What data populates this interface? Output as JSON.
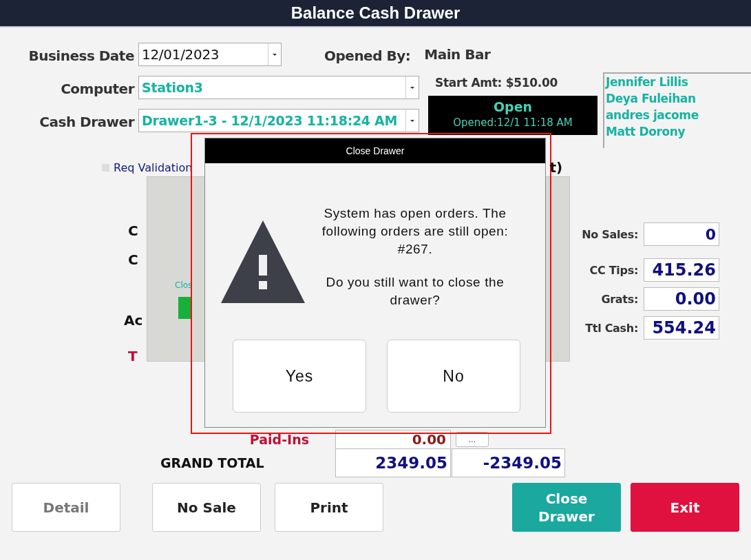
{
  "window": {
    "title": "Balance Cash Drawer"
  },
  "header": {
    "business_date": {
      "label": "Business Date",
      "value": "12/01/2023"
    },
    "computer": {
      "label": "Computer",
      "value": "Station3"
    },
    "cash_drawer": {
      "label": "Cash Drawer",
      "value": "Drawer1-3 - 12/1/2023 11:18:24 AM"
    },
    "opened_by": {
      "label": "Opened By:",
      "value": "Main Bar"
    },
    "start_amount": "Start Amt: $510.00",
    "status": {
      "label": "Open",
      "opened": "Opened:12/1 11:18 AM"
    },
    "employees": [
      "Jennifer Lillis",
      "Deya Fuleihan",
      "andres jacome",
      "Matt Dorony"
    ]
  },
  "req_validation": {
    "label": "Req Validation",
    "checked": false
  },
  "hidden_form": {
    "labels": [
      "C",
      "C",
      "Ac"
    ],
    "total_label": "T",
    "heading_fragment": "t)",
    "paid_ins": {
      "label": "Paid-Ins",
      "value": "0.00",
      "button": "..."
    },
    "grand_total": {
      "label": "GRAND TOTAL",
      "value": "2349.05",
      "difference": "-2349.05"
    }
  },
  "back_panel": {
    "caption": "Clos"
  },
  "stats": [
    {
      "label": "No Sales:",
      "value": "0"
    },
    {
      "label": "CC Tips:",
      "value": "415.26"
    },
    {
      "label": "Grats:",
      "value": "0.00"
    },
    {
      "label": "Ttl Cash:",
      "value": "554.24"
    }
  ],
  "buttons": [
    {
      "label": "Detail",
      "kind": "plain",
      "disabled": true
    },
    {
      "label": "No Sale",
      "kind": "plain",
      "disabled": false
    },
    {
      "label": "Print",
      "kind": "plain",
      "disabled": false
    },
    {
      "label": "Close Drawer",
      "kind": "primary",
      "disabled": false
    },
    {
      "label": "Exit",
      "kind": "danger",
      "disabled": false
    }
  ],
  "dialog": {
    "title": "Close Drawer",
    "message": [
      "System has open orders. The following orders are still open: #267.",
      "Do you still want to close the drawer?"
    ],
    "buttons": [
      "Yes",
      "No"
    ]
  }
}
